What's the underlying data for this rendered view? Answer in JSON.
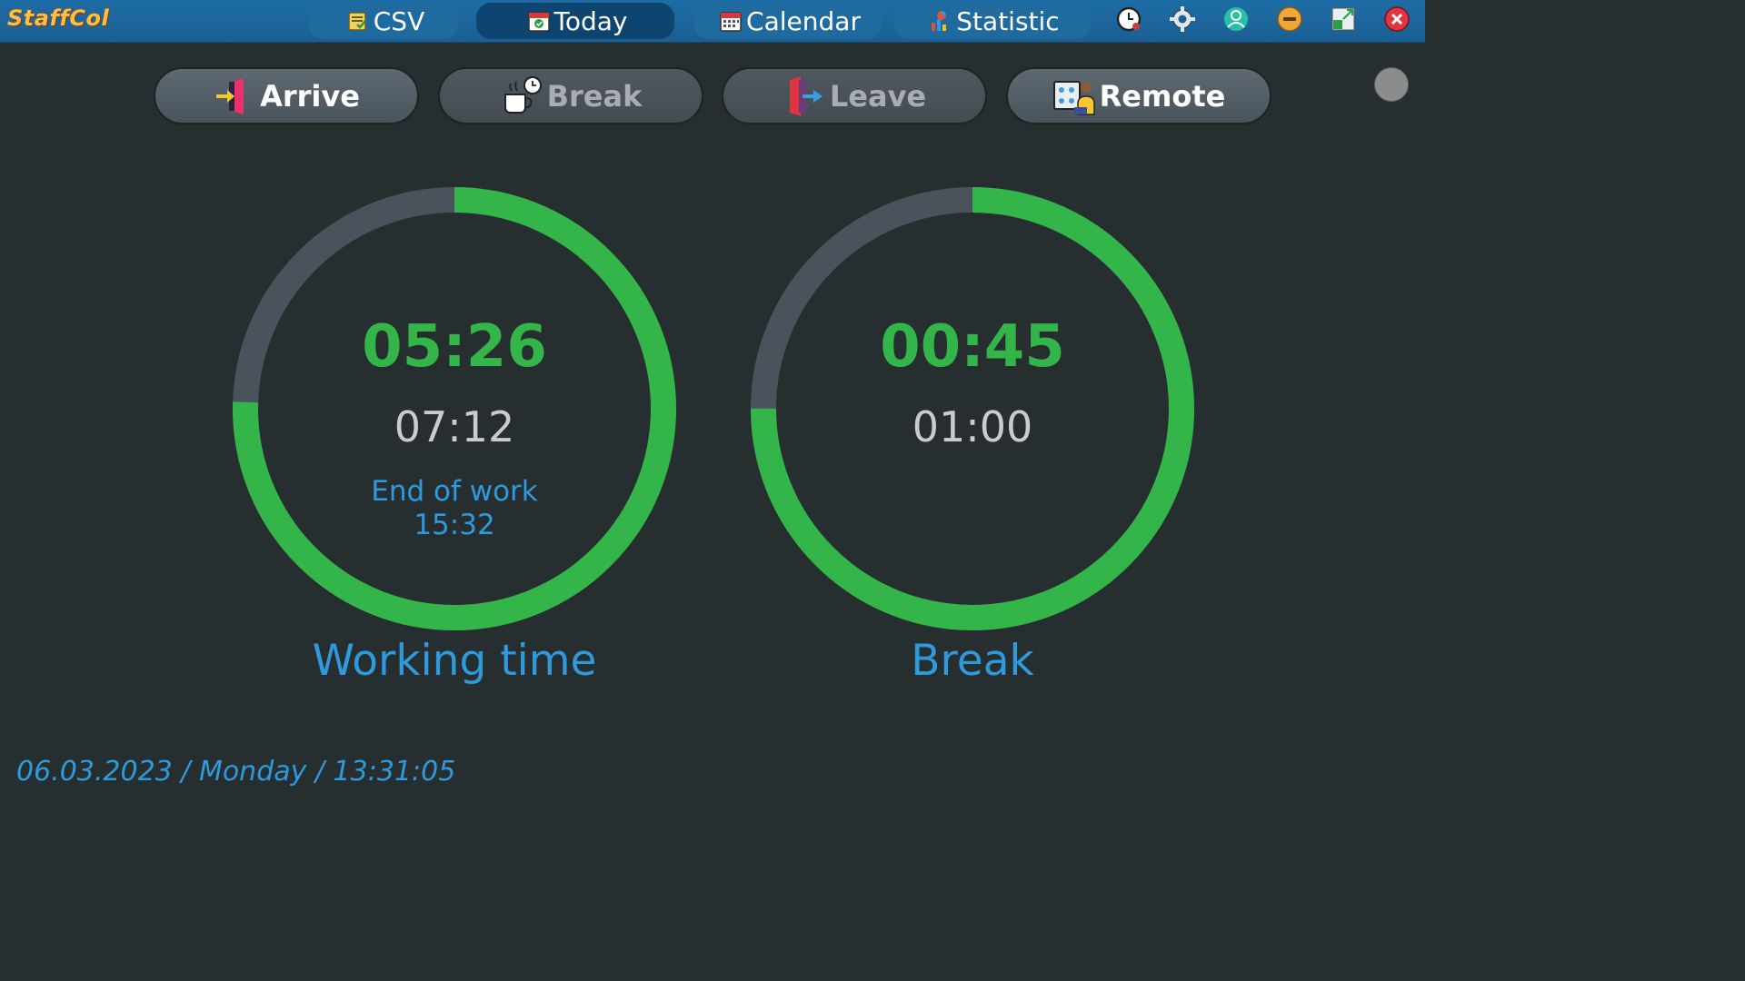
{
  "app": {
    "title": "StaffCol"
  },
  "tabs": [
    {
      "label": "CSV",
      "icon": "csv-file-icon",
      "active": false
    },
    {
      "label": "Today",
      "icon": "today-calendar-icon",
      "active": true
    },
    {
      "label": "Calendar",
      "icon": "calendar-icon",
      "active": false
    },
    {
      "label": "Statistic",
      "icon": "statistic-chart-icon",
      "active": false
    }
  ],
  "window_controls": [
    "clock-icon",
    "gear-icon",
    "user-icon",
    "minimize-icon",
    "restore-icon",
    "close-icon"
  ],
  "actions": [
    {
      "label": "Arrive",
      "icon": "arrive-door-icon",
      "enabled": true
    },
    {
      "label": "Break",
      "icon": "coffee-break-icon",
      "enabled": false
    },
    {
      "label": "Leave",
      "icon": "leave-door-icon",
      "enabled": false
    },
    {
      "label": "Remote",
      "icon": "remote-work-icon",
      "enabled": true
    }
  ],
  "working": {
    "elapsed": "05:26",
    "target": "07:12",
    "end_label": "End of work",
    "end_time": "15:32",
    "label": "Working time",
    "progress": 0.755
  },
  "break": {
    "elapsed": "00:45",
    "target": "01:00",
    "label": "Break",
    "progress": 0.75
  },
  "colors": {
    "accent_green": "#33b549",
    "track_gray": "#4a535c",
    "accent_blue": "#2f9adb",
    "titlebar": "#1a5f94"
  },
  "footer": {
    "datetime": "06.03.2023 / Monday / 13:31:05"
  }
}
